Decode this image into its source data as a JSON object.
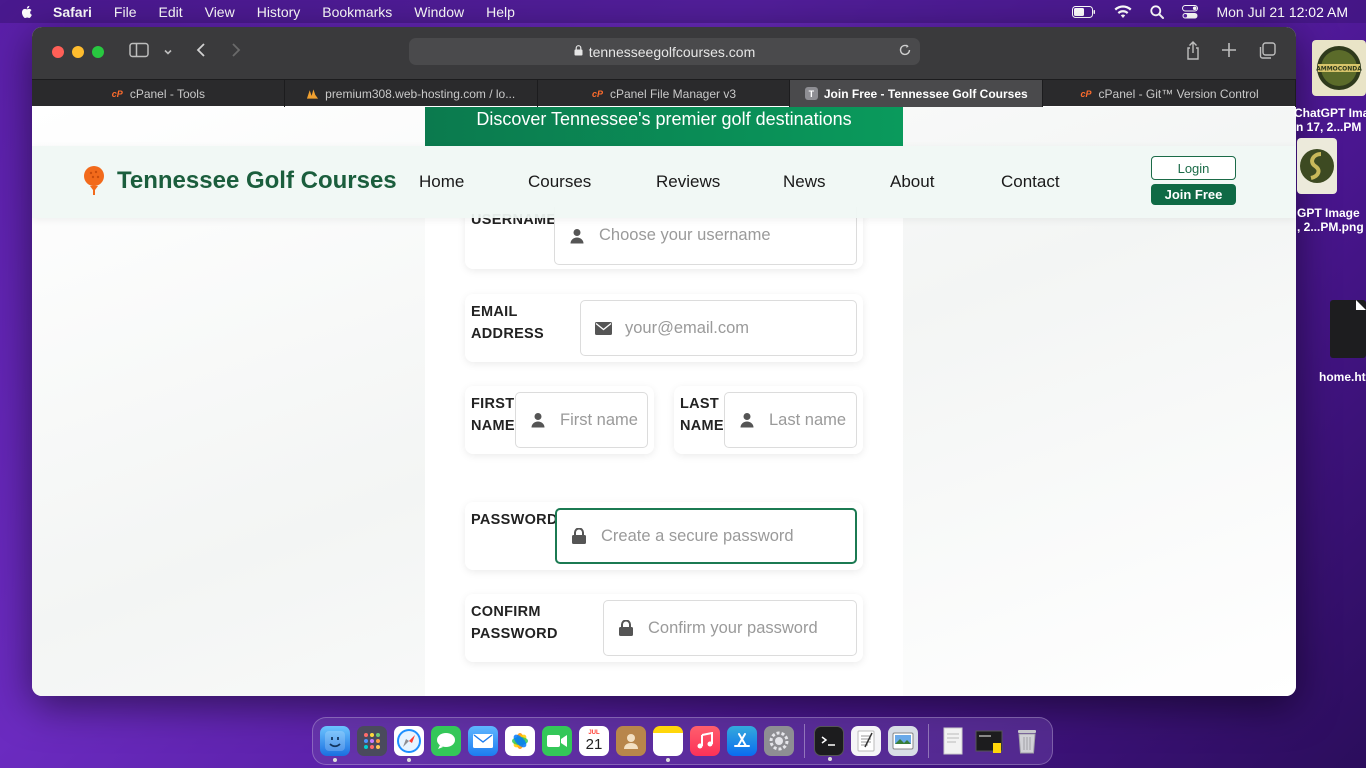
{
  "menubar": {
    "app_name": "Safari",
    "items": [
      "File",
      "Edit",
      "View",
      "History",
      "Bookmarks",
      "Window",
      "Help"
    ],
    "clock": "Mon Jul 21  12:02 AM"
  },
  "browser": {
    "url": "tennesseegolfcourses.com",
    "tabs": [
      {
        "label": "cPanel - Tools",
        "favicon": "cpanel-icon"
      },
      {
        "label": "premium308.web-hosting.com / lo...",
        "favicon": "phpmyadmin-icon"
      },
      {
        "label": "cPanel File Manager v3",
        "favicon": "cpanel-icon"
      },
      {
        "label": "Join Free - Tennessee Golf Courses",
        "favicon": "T"
      },
      {
        "label": "cPanel - Git™ Version Control",
        "favicon": "cpanel-icon"
      }
    ],
    "active_tab": 3
  },
  "site": {
    "banner": "Discover Tennessee's premier golf destinations",
    "brand": "Tennessee Golf Courses",
    "nav": [
      "Home",
      "Courses",
      "Reviews",
      "News",
      "About",
      "Contact"
    ],
    "login_label": "Login",
    "join_label": "Join Free",
    "colors": {
      "primary": "#0f6a45",
      "brand_text": "#1b5e3d",
      "logo_orange": "#f26a1b"
    }
  },
  "form": {
    "username": {
      "label": "USERNAME",
      "placeholder": "Choose your username"
    },
    "email": {
      "label_line1": "EMAIL",
      "label_line2": "ADDRESS",
      "placeholder": "your@email.com"
    },
    "first_name": {
      "label_line1": "FIRST",
      "label_line2": "NAME",
      "placeholder": "First name"
    },
    "last_name": {
      "label_line1": "LAST",
      "label_line2": "NAME",
      "placeholder": "Last name"
    },
    "password": {
      "label": "PASSWORD",
      "placeholder": "Create a secure password"
    },
    "confirm_password": {
      "label_line1": "CONFIRM",
      "label_line2": "PASSWORD",
      "placeholder": "Confirm your password"
    }
  },
  "desktop": {
    "icons": [
      {
        "label_line1": "ChatGPT Ima",
        "label_line2": "n 17, 2...PM"
      },
      {
        "label_line1": "GPT Image",
        "label_line2": ", 2...PM.png"
      },
      {
        "label": "home.ht"
      }
    ],
    "thumb_text": "AMMOCONDA"
  },
  "dock": {
    "calendar_month": "JUL",
    "calendar_day": "21"
  }
}
